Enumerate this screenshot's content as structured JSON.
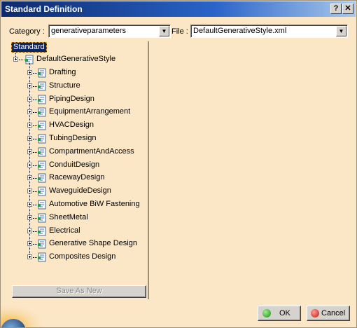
{
  "window": {
    "title": "Standard Definition",
    "help_glyph": "?",
    "close_glyph": "✕"
  },
  "category": {
    "label": "Category :",
    "value": "generativeparameters"
  },
  "file": {
    "label": "File :",
    "value": "DefaultGenerativeStyle.xml"
  },
  "tree": {
    "root_label": "Standard",
    "style_node": "DefaultGenerativeStyle",
    "children": [
      "Drafting",
      "Structure",
      "PipingDesign",
      "EquipmentArrangement",
      "HVACDesign",
      "TubingDesign",
      "CompartmentAndAccess",
      "ConduitDesign",
      "RacewayDesign",
      "WaveguideDesign",
      "Automotive BiW Fastening",
      "SheetMetal",
      "Electrical",
      "Generative Shape Design",
      "Composites Design"
    ]
  },
  "buttons": {
    "save_as_new": "Save As New",
    "ok": "OK",
    "cancel": "Cancel"
  },
  "colors": {
    "panel_bg": "#fbe6c6",
    "title_start": "#0c2a6d",
    "title_end": "#a9c8ec",
    "selection": "#0a246a"
  }
}
